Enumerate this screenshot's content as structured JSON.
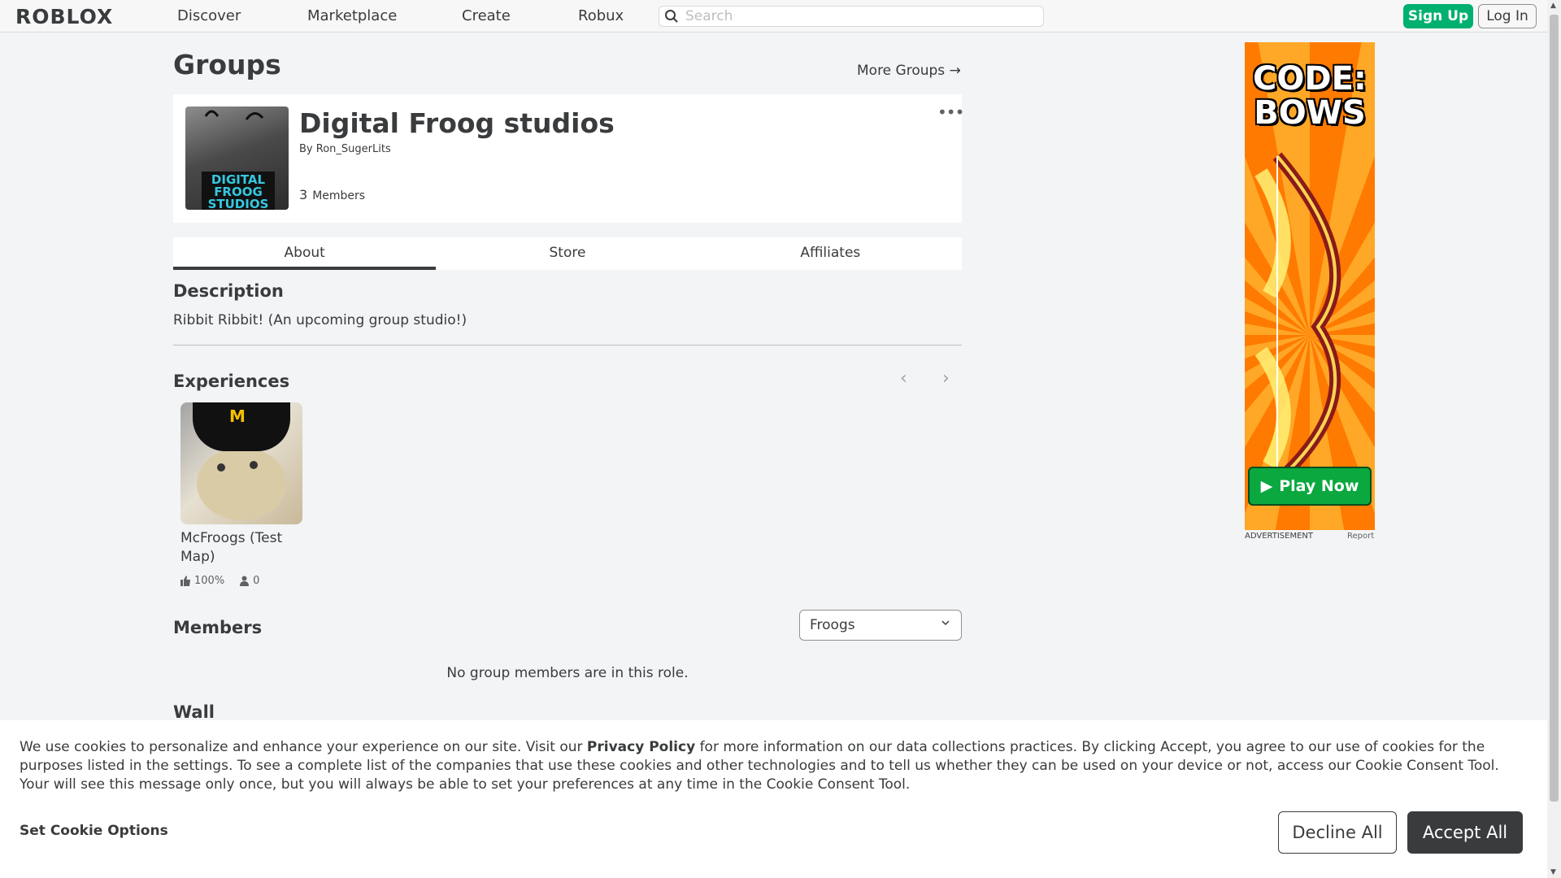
{
  "header": {
    "logo": "ROBLOX",
    "nav": [
      "Discover",
      "Marketplace",
      "Create",
      "Robux"
    ],
    "search_placeholder": "Search",
    "signup": "Sign Up",
    "login": "Log In"
  },
  "page": {
    "title": "Groups",
    "more_groups": "More Groups →"
  },
  "group": {
    "name": "Digital Froog studios",
    "by_prefix": "By",
    "owner": "Ron_SugerLits",
    "member_count": "3",
    "members_label": "Members",
    "emblem_text": "DIGITAL FROOG STUDIOS",
    "more_menu": "•••"
  },
  "tabs": [
    "About",
    "Store",
    "Affiliates"
  ],
  "about": {
    "description_title": "Description",
    "description": "Ribbit Ribbit! (An upcoming group studio!)",
    "experiences_title": "Experiences",
    "experiences": [
      {
        "title": "McFroogs (Test Map)",
        "rating": "100%",
        "players": "0"
      }
    ],
    "members_title": "Members",
    "role_selected": "Froogs",
    "empty_members": "No group members are in this role.",
    "wall_title": "Wall"
  },
  "ad": {
    "title": "CODE: BOWS",
    "play": "Play Now",
    "label": "ADVERTISEMENT",
    "report": "Report"
  },
  "cookie": {
    "text_before": "We use cookies to personalize and enhance your experience on our site. Visit our ",
    "privacy_link": "Privacy Policy",
    "text_after": " for more information on our data collections practices. By clicking Accept, you agree to our use of cookies for the purposes listed in the settings. To see a complete list of the companies that use these cookies and other technologies and to tell us whether they can be used on your device or not, access our Cookie Consent Tool. Your will see this message only once, but you will always be able to set your preferences at any time in the Cookie Consent Tool.",
    "set_options": "Set Cookie Options",
    "decline": "Decline All",
    "accept": "Accept All"
  },
  "colors": {
    "accent_green": "#00b06f",
    "text_dark": "#393b3d",
    "page_bg": "#f2f4f5"
  }
}
